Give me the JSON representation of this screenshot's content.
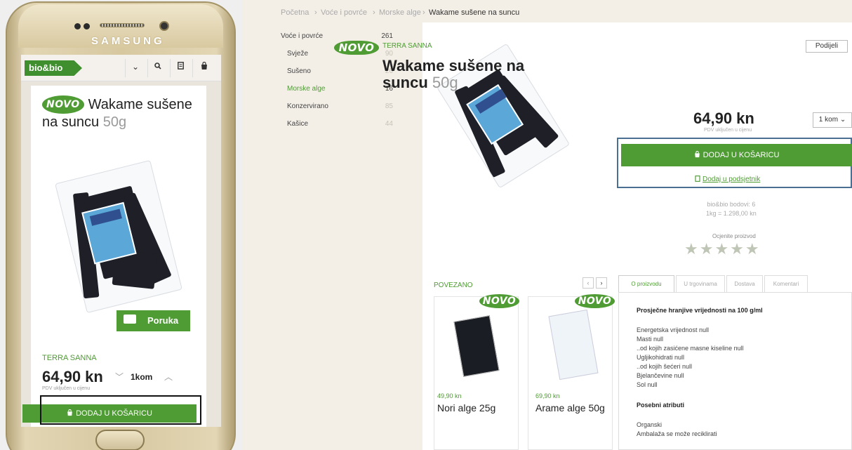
{
  "mobile": {
    "brand_text": "SAMSUNG",
    "logo": "bio&bio",
    "header_icons": [
      "chevron-down-icon",
      "search-icon",
      "wishlist-icon",
      "cart-icon"
    ],
    "novo": "NOVO",
    "title": "Wakame sušene na suncu",
    "weight": "50g",
    "brand": "TERRA SANNA",
    "price": "64,90 kn",
    "vat": "PDV uključen u cijenu",
    "qty": "1kom",
    "message_label": "Poruka",
    "cart_label": "DODAJ U KOŠARICU"
  },
  "breadcrumb": [
    "Početna",
    "Voće i povrće",
    "Morske alge",
    "Wakame sušene na suncu"
  ],
  "categories": [
    {
      "label": "Voće i povrće",
      "count": "261"
    },
    {
      "label": "Svježe",
      "count": "90"
    },
    {
      "label": "Sušeno",
      "count": "26"
    },
    {
      "label": "Morske alge",
      "count": "16"
    },
    {
      "label": "Konzervirano",
      "count": "85"
    },
    {
      "label": "Kašice",
      "count": "44"
    }
  ],
  "product": {
    "novo": "NOVO",
    "brand": "TERRA SANNA",
    "share": "Podijeli",
    "title": "Wakame sušene na suncu",
    "weight": "50g",
    "price": "64,90 kn",
    "vat": "PDV uključen u cijenu",
    "qty": "1 kom",
    "cart_label": "DODAJ U KOŠARICU",
    "wishlist_label": "Dodaj u podsjetnik",
    "points": "bio&bio bodovi: 6",
    "unit_price": "1kg = 1.298,00 kn",
    "rate_label": "Ocjenite proizvod",
    "stars": "★★★★★"
  },
  "related": {
    "title": "POVEZANO",
    "items": [
      {
        "novo": "NOVO",
        "price": "49,90 kn",
        "name": "Nori alge 25g"
      },
      {
        "novo": "NOVO",
        "price": "69,90 kn",
        "name": "Arame alge 50g"
      }
    ]
  },
  "tabs": [
    "O proizvodu",
    "U trgovinama",
    "Dostava",
    "Komentari"
  ],
  "nutrition": {
    "heading": "Prosječne hranjive vrijednosti na 100 g/ml",
    "lines": [
      "Energetska vrijednost null",
      "Masti null",
      "..od kojih zasićene masne kiseline null",
      "Ugljikohidrati null",
      "..od kojih šećeri null",
      "Bjelančevine null",
      "Sol null"
    ],
    "attr_heading": "Posebni atributi",
    "attrs": [
      "Organski",
      "Ambalaža se može reciklirati"
    ]
  },
  "colors": {
    "brand_green": "#4f9b34",
    "frame_blue": "#4a6f93",
    "background": "#f3efe7"
  }
}
